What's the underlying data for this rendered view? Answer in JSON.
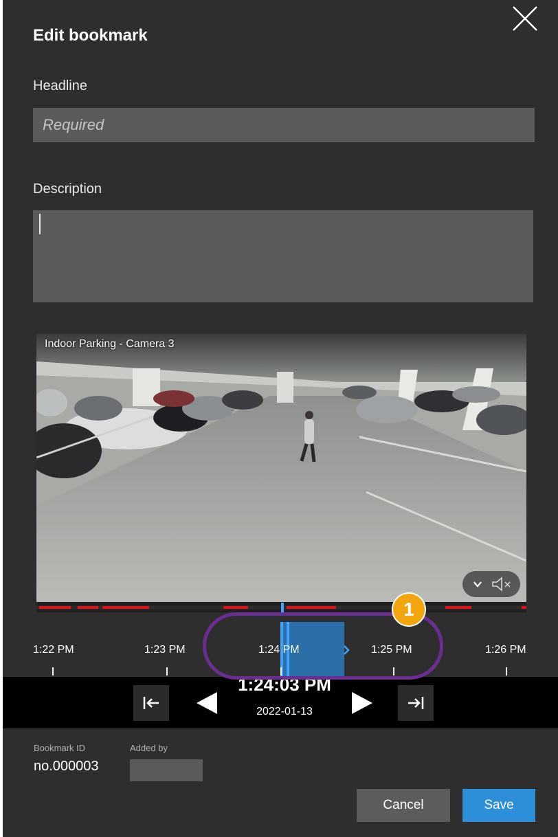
{
  "dialog": {
    "title": "Edit bookmark",
    "close_icon": "close-icon"
  },
  "form": {
    "headline_label": "Headline",
    "headline_placeholder": "Required",
    "headline_value": "",
    "description_label": "Description",
    "description_value": ""
  },
  "video": {
    "camera_label": "Indoor Parking - Camera 3",
    "audio_icon": "speaker-muted-icon",
    "menu_icon": "chevron-down-icon"
  },
  "timeline": {
    "ticks": [
      "1:22 PM",
      "1:23 PM",
      "1:24 PM",
      "1:25 PM",
      "1:26 PM"
    ],
    "callout_number": "1"
  },
  "playback": {
    "current_time": "1:24:03 PM",
    "current_date": "2022-01-13",
    "jump_start_icon": "skip-to-start-icon",
    "play_back_icon": "play-reverse-icon",
    "play_forward_icon": "play-forward-icon",
    "jump_end_icon": "skip-to-end-icon"
  },
  "meta": {
    "bookmark_id_label": "Bookmark ID",
    "bookmark_id_value": "no.000003",
    "added_by_label": "Added by"
  },
  "actions": {
    "cancel_label": "Cancel",
    "save_label": "Save"
  },
  "colors": {
    "dialog_bg": "#2e2e2e",
    "input_bg": "#5b5b5b",
    "accent_blue": "#2d8fd9",
    "recording_red": "#e0101a",
    "callout_purple": "#6a2e93",
    "callout_orange": "#f3a50d"
  }
}
